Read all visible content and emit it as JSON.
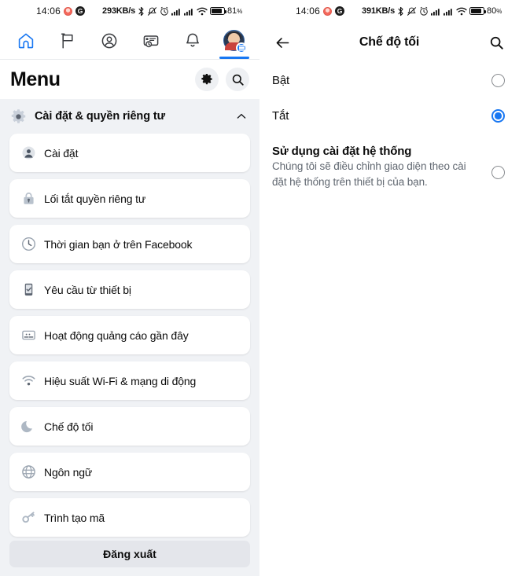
{
  "left": {
    "statusbar": {
      "time": "14:06",
      "emoji_icon": "emoji-face-icon",
      "g_icon": "google-g-icon",
      "data_rate": "293KB/s",
      "bluetooth_icon": "bluetooth-icon",
      "mute_icon": "mute-icon",
      "alarm_icon": "alarm-icon",
      "signal1_icon": "signal-bars-icon",
      "signal2_icon": "signal-bars-icon",
      "wifi_icon": "wifi-icon",
      "battery_icon": "battery-icon",
      "battery_percent": "81",
      "battery_unit": "%",
      "battery_level": 81
    },
    "tabs": [
      {
        "name": "home",
        "icon": "home-icon",
        "active": true,
        "color": "#1877F2"
      },
      {
        "name": "pages",
        "icon": "flag-icon",
        "active": false,
        "color": "#3a3c40"
      },
      {
        "name": "friends",
        "icon": "profile-circle-icon",
        "active": false,
        "color": "#3a3c40"
      },
      {
        "name": "marketplace",
        "icon": "marketplace-card-icon",
        "active": false,
        "color": "#3a3c40"
      },
      {
        "name": "notifications",
        "icon": "bell-icon",
        "active": false,
        "color": "#3a3c40"
      },
      {
        "name": "menu",
        "icon": "avatar-menu-icon",
        "active": true,
        "color": "#1877F2"
      }
    ],
    "header": {
      "title": "Menu",
      "settings_icon": "gear-icon",
      "search_icon": "search-icon"
    },
    "section": {
      "icon": "gear-icon",
      "label": "Cài đặt & quyền riêng tư",
      "collapse_icon": "chevron-up-icon"
    },
    "items": [
      {
        "label": "Cài đặt",
        "icon": "profile-badge-icon"
      },
      {
        "label": "Lối tắt quyền riêng tư",
        "icon": "lock-icon"
      },
      {
        "label": "Thời gian bạn ở trên Facebook",
        "icon": "clock-icon"
      },
      {
        "label": "Yêu cầu từ thiết bị",
        "icon": "device-phone-icon"
      },
      {
        "label": "Hoạt động quảng cáo gần đây",
        "icon": "ad-activity-icon"
      },
      {
        "label": "Hiệu suất Wi-Fi & mạng di động",
        "icon": "wifi-icon"
      },
      {
        "label": "Chế độ tối",
        "icon": "moon-icon"
      },
      {
        "label": "Ngôn ngữ",
        "icon": "globe-icon"
      },
      {
        "label": "Trình tạo mã",
        "icon": "key-icon"
      }
    ],
    "logout": "Đăng xuất"
  },
  "right": {
    "statusbar": {
      "time": "14:06",
      "emoji_icon": "emoji-face-icon",
      "g_icon": "google-g-icon",
      "data_rate": "391KB/s",
      "bluetooth_icon": "bluetooth-icon",
      "mute_icon": "mute-icon",
      "alarm_icon": "alarm-icon",
      "signal1_icon": "signal-bars-icon",
      "signal2_icon": "signal-bars-icon",
      "wifi_icon": "wifi-icon",
      "battery_icon": "battery-icon",
      "battery_percent": "80",
      "battery_unit": "%",
      "battery_level": 80
    },
    "header": {
      "back_icon": "back-arrow-icon",
      "title": "Chế độ tối",
      "search_icon": "search-icon"
    },
    "options": [
      {
        "title": "Bật",
        "description": "",
        "selected": false,
        "bold": false
      },
      {
        "title": "Tắt",
        "description": "",
        "selected": true,
        "bold": false
      },
      {
        "title": "Sử dụng cài đặt hệ thống",
        "description": "Chúng tôi sẽ điều chỉnh giao diện theo cài đặt hệ thống trên thiết bị của bạn.",
        "selected": false,
        "bold": true
      }
    ]
  },
  "colors": {
    "accent": "#1877F2",
    "menu_bg": "#f0f2f5",
    "card_bg": "#ffffff",
    "text": "#0b0b0b",
    "subtext": "#606770"
  }
}
